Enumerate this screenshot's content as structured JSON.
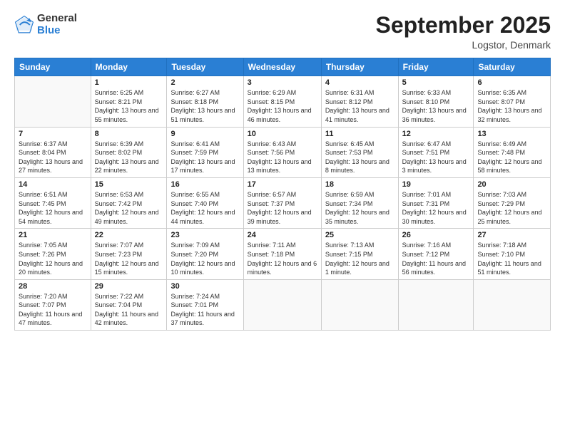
{
  "logo": {
    "general": "General",
    "blue": "Blue"
  },
  "header": {
    "title": "September 2025",
    "subtitle": "Logstor, Denmark"
  },
  "weekdays": [
    "Sunday",
    "Monday",
    "Tuesday",
    "Wednesday",
    "Thursday",
    "Friday",
    "Saturday"
  ],
  "weeks": [
    [
      {
        "day": "",
        "empty": true
      },
      {
        "day": "1",
        "sunrise": "6:25 AM",
        "sunset": "8:21 PM",
        "daylight": "13 hours and 55 minutes."
      },
      {
        "day": "2",
        "sunrise": "6:27 AM",
        "sunset": "8:18 PM",
        "daylight": "13 hours and 51 minutes."
      },
      {
        "day": "3",
        "sunrise": "6:29 AM",
        "sunset": "8:15 PM",
        "daylight": "13 hours and 46 minutes."
      },
      {
        "day": "4",
        "sunrise": "6:31 AM",
        "sunset": "8:12 PM",
        "daylight": "13 hours and 41 minutes."
      },
      {
        "day": "5",
        "sunrise": "6:33 AM",
        "sunset": "8:10 PM",
        "daylight": "13 hours and 36 minutes."
      },
      {
        "day": "6",
        "sunrise": "6:35 AM",
        "sunset": "8:07 PM",
        "daylight": "13 hours and 32 minutes."
      }
    ],
    [
      {
        "day": "7",
        "sunrise": "6:37 AM",
        "sunset": "8:04 PM",
        "daylight": "13 hours and 27 minutes."
      },
      {
        "day": "8",
        "sunrise": "6:39 AM",
        "sunset": "8:02 PM",
        "daylight": "13 hours and 22 minutes."
      },
      {
        "day": "9",
        "sunrise": "6:41 AM",
        "sunset": "7:59 PM",
        "daylight": "13 hours and 17 minutes."
      },
      {
        "day": "10",
        "sunrise": "6:43 AM",
        "sunset": "7:56 PM",
        "daylight": "13 hours and 13 minutes."
      },
      {
        "day": "11",
        "sunrise": "6:45 AM",
        "sunset": "7:53 PM",
        "daylight": "13 hours and 8 minutes."
      },
      {
        "day": "12",
        "sunrise": "6:47 AM",
        "sunset": "7:51 PM",
        "daylight": "13 hours and 3 minutes."
      },
      {
        "day": "13",
        "sunrise": "6:49 AM",
        "sunset": "7:48 PM",
        "daylight": "12 hours and 58 minutes."
      }
    ],
    [
      {
        "day": "14",
        "sunrise": "6:51 AM",
        "sunset": "7:45 PM",
        "daylight": "12 hours and 54 minutes."
      },
      {
        "day": "15",
        "sunrise": "6:53 AM",
        "sunset": "7:42 PM",
        "daylight": "12 hours and 49 minutes."
      },
      {
        "day": "16",
        "sunrise": "6:55 AM",
        "sunset": "7:40 PM",
        "daylight": "12 hours and 44 minutes."
      },
      {
        "day": "17",
        "sunrise": "6:57 AM",
        "sunset": "7:37 PM",
        "daylight": "12 hours and 39 minutes."
      },
      {
        "day": "18",
        "sunrise": "6:59 AM",
        "sunset": "7:34 PM",
        "daylight": "12 hours and 35 minutes."
      },
      {
        "day": "19",
        "sunrise": "7:01 AM",
        "sunset": "7:31 PM",
        "daylight": "12 hours and 30 minutes."
      },
      {
        "day": "20",
        "sunrise": "7:03 AM",
        "sunset": "7:29 PM",
        "daylight": "12 hours and 25 minutes."
      }
    ],
    [
      {
        "day": "21",
        "sunrise": "7:05 AM",
        "sunset": "7:26 PM",
        "daylight": "12 hours and 20 minutes."
      },
      {
        "day": "22",
        "sunrise": "7:07 AM",
        "sunset": "7:23 PM",
        "daylight": "12 hours and 15 minutes."
      },
      {
        "day": "23",
        "sunrise": "7:09 AM",
        "sunset": "7:20 PM",
        "daylight": "12 hours and 10 minutes."
      },
      {
        "day": "24",
        "sunrise": "7:11 AM",
        "sunset": "7:18 PM",
        "daylight": "12 hours and 6 minutes."
      },
      {
        "day": "25",
        "sunrise": "7:13 AM",
        "sunset": "7:15 PM",
        "daylight": "12 hours and 1 minute."
      },
      {
        "day": "26",
        "sunrise": "7:16 AM",
        "sunset": "7:12 PM",
        "daylight": "11 hours and 56 minutes."
      },
      {
        "day": "27",
        "sunrise": "7:18 AM",
        "sunset": "7:10 PM",
        "daylight": "11 hours and 51 minutes."
      }
    ],
    [
      {
        "day": "28",
        "sunrise": "7:20 AM",
        "sunset": "7:07 PM",
        "daylight": "11 hours and 47 minutes."
      },
      {
        "day": "29",
        "sunrise": "7:22 AM",
        "sunset": "7:04 PM",
        "daylight": "11 hours and 42 minutes."
      },
      {
        "day": "30",
        "sunrise": "7:24 AM",
        "sunset": "7:01 PM",
        "daylight": "11 hours and 37 minutes."
      },
      {
        "day": "",
        "empty": true
      },
      {
        "day": "",
        "empty": true
      },
      {
        "day": "",
        "empty": true
      },
      {
        "day": "",
        "empty": true
      }
    ]
  ],
  "labels": {
    "sunrise": "Sunrise:",
    "sunset": "Sunset:",
    "daylight": "Daylight:"
  }
}
